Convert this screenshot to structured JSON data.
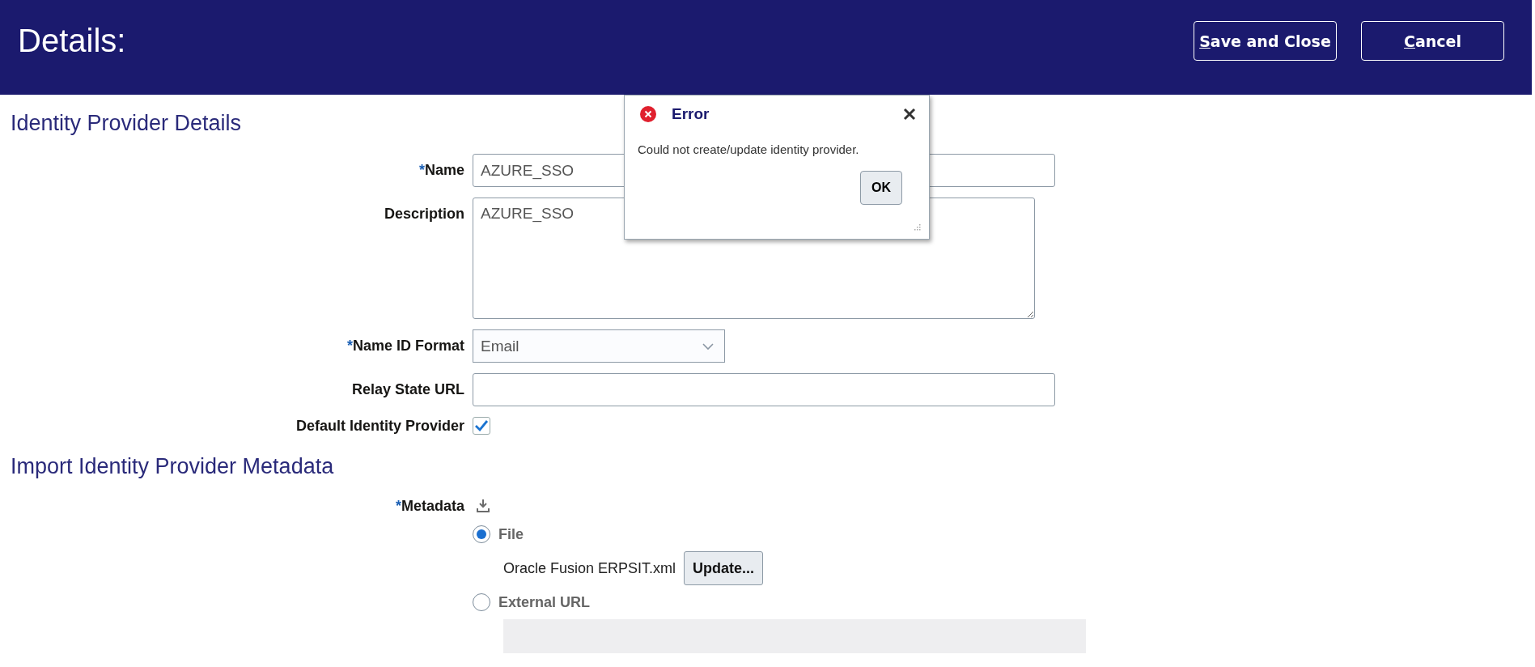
{
  "header": {
    "title": "Details:",
    "buttons": [
      {
        "label": "Save and Close"
      },
      {
        "label": "Cancel"
      }
    ]
  },
  "identity_section": {
    "title": "Identity Provider Details",
    "fields": [
      {
        "kind": "text",
        "label": "Name",
        "required_marker": "*",
        "value": "AZURE_SSO"
      },
      {
        "kind": "textarea",
        "label": "Description",
        "value": "AZURE_SSO"
      },
      {
        "kind": "select",
        "label": "Name ID Format",
        "required_marker": "*",
        "value": "Email"
      },
      {
        "kind": "text",
        "label": "Relay State URL"
      },
      {
        "kind": "checkbox",
        "label": "Default Identity Provider",
        "checked": true
      }
    ]
  },
  "import_section": {
    "title": "Import Identity Provider Metadata",
    "metadata": {
      "label": "Metadata",
      "required_marker": "*",
      "options": [
        {
          "label": "File",
          "selected": true,
          "file_name": "Oracle Fusion ERPSIT.xml",
          "button": "Update..."
        },
        {
          "label": "External URL",
          "selected": false
        }
      ]
    }
  },
  "dialog": {
    "title": "Error",
    "message": "Could not create/update identity provider.",
    "button": "OK"
  }
}
